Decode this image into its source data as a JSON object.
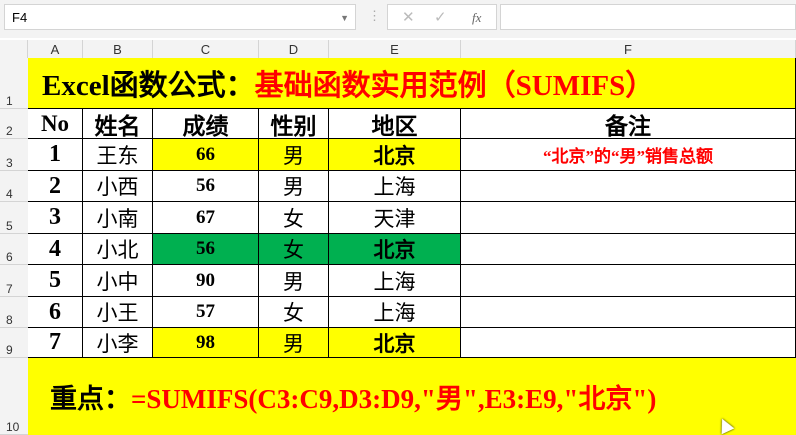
{
  "formula_bar": {
    "name_box": "F4",
    "cancel_icon": "✕",
    "enter_icon": "✓",
    "fx_label": "fx",
    "formula": ""
  },
  "columns": [
    "A",
    "B",
    "C",
    "D",
    "E",
    "F"
  ],
  "rows": [
    "1",
    "2",
    "3",
    "4",
    "5",
    "6",
    "7",
    "8",
    "9",
    "10"
  ],
  "title": {
    "black": "Excel函数公式：",
    "red": "基础函数实用范例（SUMIFS）"
  },
  "headers": [
    "No",
    "姓名",
    "成绩",
    "性别",
    "地区",
    "备注"
  ],
  "data": [
    [
      "1",
      "王东",
      "66",
      "男",
      "北京",
      "“北京”的“男”销售总额"
    ],
    [
      "2",
      "小西",
      "56",
      "男",
      "上海",
      ""
    ],
    [
      "3",
      "小南",
      "67",
      "女",
      "天津",
      ""
    ],
    [
      "4",
      "小北",
      "56",
      "女",
      "北京",
      ""
    ],
    [
      "5",
      "小中",
      "90",
      "男",
      "上海",
      ""
    ],
    [
      "6",
      "小王",
      "57",
      "女",
      "上海",
      ""
    ],
    [
      "7",
      "小李",
      "98",
      "男",
      "北京",
      ""
    ]
  ],
  "highlight_colors": {
    "yellow": "#ffff00",
    "green": "#00b050",
    "red": "#ff0000"
  },
  "footer": {
    "label": "重点：",
    "formula": "=SUMIFS(C3:C9,D3:D9,\"男\",E3:E9,\"北京\")"
  }
}
